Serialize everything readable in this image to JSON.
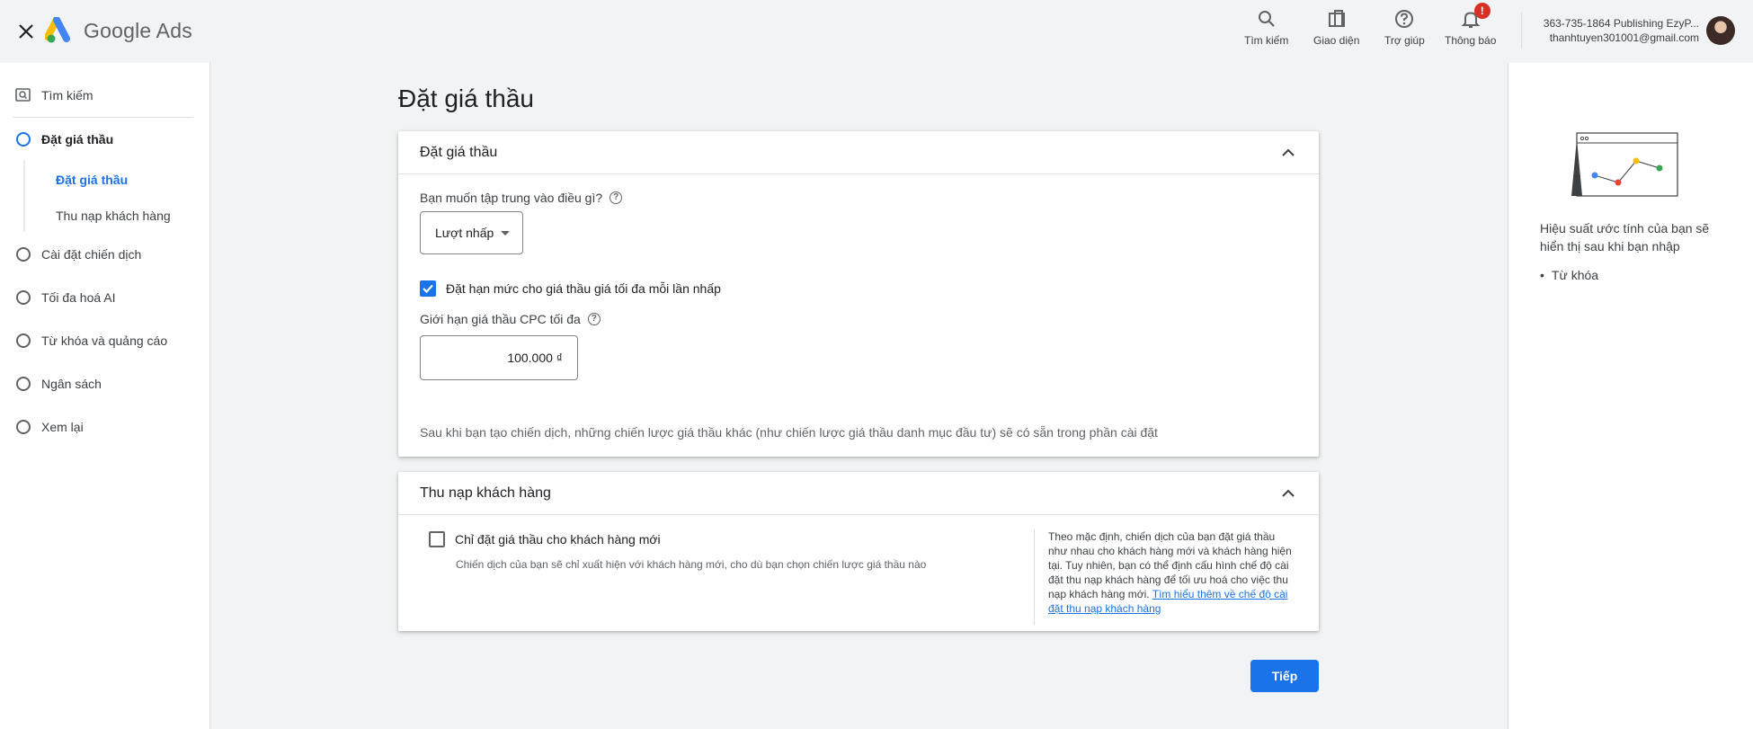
{
  "app": {
    "brand": "Google Ads"
  },
  "topbar": {
    "actions": [
      {
        "label": "Tìm kiếm",
        "icon": "search-icon"
      },
      {
        "label": "Giao diện",
        "icon": "appearance-icon"
      },
      {
        "label": "Trợ giúp",
        "icon": "help-icon"
      },
      {
        "label": "Thông báo",
        "icon": "bell-icon",
        "badge": "!"
      }
    ],
    "account": {
      "line1": "363-735-1864 Publishing EzyP...",
      "email": "thanhtuyen301001@gmail.com"
    }
  },
  "sidebar": {
    "search_label": "Tìm kiếm",
    "items": [
      {
        "label": "Đặt giá thầu",
        "active": true
      },
      {
        "label": "Cài đặt chiến dịch"
      },
      {
        "label": "Tối đa hoá AI"
      },
      {
        "label": "Từ khóa và quảng cáo"
      },
      {
        "label": "Ngân sách"
      },
      {
        "label": "Xem lại"
      }
    ],
    "subitems": [
      {
        "label": "Đặt giá thầu",
        "active": true
      },
      {
        "label": "Thu nạp khách hàng"
      }
    ]
  },
  "main": {
    "title": "Đặt giá thầu",
    "bidding": {
      "header": "Đặt giá thầu",
      "focus_question": "Bạn muốn tập trung vào điều gì?",
      "focus_value": "Lượt nhấp",
      "limit_checkbox_label": "Đặt hạn mức cho giá thầu giá tối đa mỗi lần nhấp",
      "limit_checked": true,
      "cpc_label": "Giới hạn giá thầu CPC tối đa",
      "cpc_value": "100.000 ₫",
      "note": "Sau khi bạn tạo chiến dịch, những chiến lược giá thầu khác (như chiến lược giá thầu danh mục đầu tư) sẽ có sẵn trong phần cài đặt"
    },
    "acquisition": {
      "header": "Thu nạp khách hàng",
      "checkbox_label": "Chỉ đặt giá thầu cho khách hàng mới",
      "checked": false,
      "description": "Chiến dịch của bạn sẽ chỉ xuất hiện với khách hàng mới, cho dù bạn chọn chiến lược giá thầu nào",
      "info_text": "Theo mặc định, chiến dịch của bạn đặt giá thầu như nhau cho khách hàng mới và khách hàng hiện tại. Tuy nhiên, bạn có thể định cấu hình chế độ cài đặt thu nạp khách hàng để tối ưu hoá cho việc thu nạp khách hàng mới.",
      "info_link": "Tìm hiểu thêm về chế độ cài đặt thu nạp khách hàng"
    },
    "next_button": "Tiếp"
  },
  "right_panel": {
    "text": "Hiệu suất ước tính của bạn sẽ hiển thị sau khi bạn nhập",
    "list": [
      "Từ khóa"
    ]
  },
  "colors": {
    "accent": "#1a73e8",
    "badge": "#d93025",
    "background": "#f1f3f4"
  }
}
